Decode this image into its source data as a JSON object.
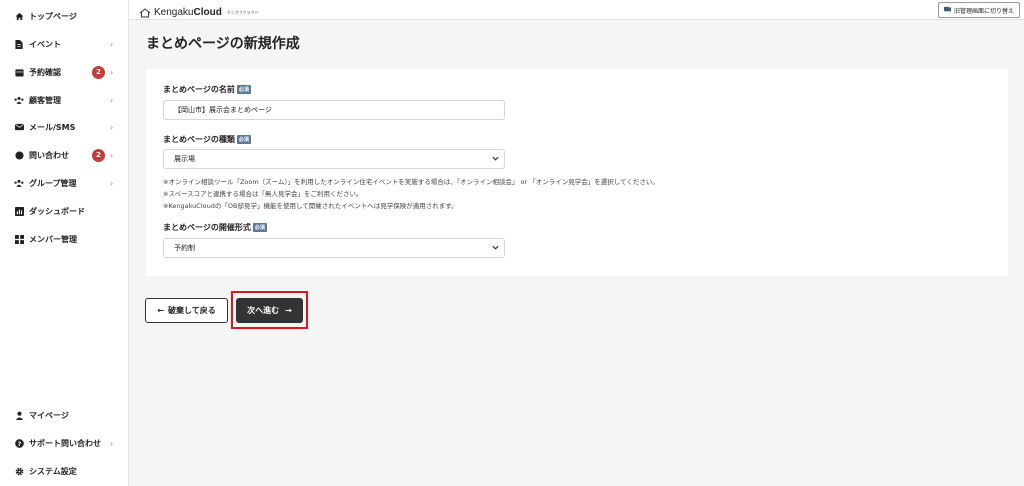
{
  "header": {
    "logo_text_light": "Kengaku",
    "logo_text_bold": "Cloud",
    "logo_sub": "ケンガククラウド",
    "switch_label": "旧管理画面に切り替え"
  },
  "sidebar": {
    "items": [
      {
        "label": "トップページ",
        "icon": "home-icon"
      },
      {
        "label": "イベント",
        "icon": "document-icon",
        "chevron": "›"
      },
      {
        "label": "予約確認",
        "icon": "calendar-icon",
        "badge": "2",
        "chevron": "›"
      },
      {
        "label": "顧客管理",
        "icon": "users-icon",
        "chevron": "›"
      },
      {
        "label": "メール/SMS",
        "icon": "mail-icon",
        "chevron": "›"
      },
      {
        "label": "問い合わせ",
        "icon": "chat-icon",
        "badge": "2",
        "chevron": "›"
      },
      {
        "label": "グループ管理",
        "icon": "group-icon",
        "chevron": "›"
      },
      {
        "label": "ダッシュボード",
        "icon": "chart-icon"
      },
      {
        "label": "メンバー管理",
        "icon": "grid-icon"
      }
    ],
    "bottom_items": [
      {
        "label": "マイページ",
        "icon": "user-icon"
      },
      {
        "label": "サポート問い合わせ",
        "icon": "help-icon",
        "chevron": "›"
      },
      {
        "label": "システム設定",
        "icon": "gear-icon"
      }
    ]
  },
  "main": {
    "title": "まとめページの新規作成",
    "required_label": "必須",
    "fields": {
      "name_label": "まとめページの名前",
      "name_value": "【岡山市】展示会まとめページ",
      "type_label": "まとめページの種類",
      "type_value": "展示場",
      "format_label": "まとめページの開催形式",
      "format_value": "予約制"
    },
    "notes": [
      "※オンライン相談ツール「Zoom（ズーム）」を利用したオンライン住宅イベントを実施する場合は、「オンライン相談会」 or 「オンライン見学会」を選択してください。",
      "※スペースコアと連携する場合は「無人見学会」をご利用ください。",
      "※KengakuCloudの「OB邸見学」機能を使用して開催されたイベントへは見学保険が適用されます。"
    ],
    "back_button": "破棄して戻る",
    "next_button": "次へ進む",
    "back_arrow": "←",
    "next_arrow": "→"
  },
  "colors": {
    "badge": "#c63c3c",
    "required_tag": "#5a7a96",
    "primary_button": "#333333",
    "highlight": "#e0161b"
  }
}
